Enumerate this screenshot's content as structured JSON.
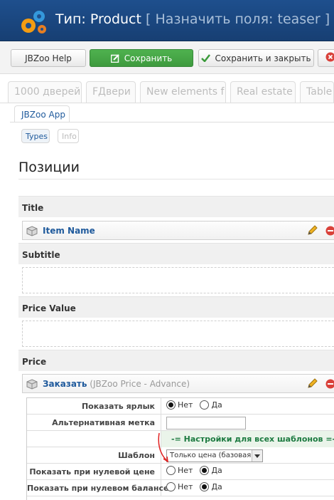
{
  "header": {
    "title_main": "Тип: Product",
    "title_sub": " [ Назначить поля: teaser ]"
  },
  "toolbar": {
    "help_label": "JBZoo Help",
    "save_label": "Сохранить",
    "save_close_label": "Сохранить и закрыть"
  },
  "tabs": [
    {
      "label": "1000 дверей"
    },
    {
      "label": "FДвери"
    },
    {
      "label": "New elements f"
    },
    {
      "label": "Real estate"
    },
    {
      "label": "Table"
    }
  ],
  "app_tab": {
    "label": "JBZoo App"
  },
  "pills": {
    "types": "Types",
    "info": "Info"
  },
  "page": {
    "heading": "Позиции"
  },
  "positions": [
    {
      "title": "Title"
    },
    {
      "title": "Subtitle"
    },
    {
      "title": "Price Value"
    },
    {
      "title": "Price"
    }
  ],
  "elements": {
    "item_name": {
      "name": "Item Name"
    },
    "order": {
      "name": "Заказать",
      "meta": " (JBZoo Price - Advance)"
    }
  },
  "settings": {
    "show_label": "Показать ярлык",
    "alt_label": "Альтернативная метка",
    "banner": "-= Настройки для всех шаблонов =-",
    "template_label": "Шаблон",
    "template_value": "Только цена (базовая)",
    "zero_price_label": "Показать при нулевой цене",
    "zero_balance_label": "Показать при нулевом балансе",
    "no": "Нет",
    "yes": "Да"
  },
  "colors": {
    "header_bg": "#1e4f8d",
    "save_green": "#4fb24f",
    "link_blue": "#1f5a9c",
    "banner_green": "#1c7a40"
  }
}
